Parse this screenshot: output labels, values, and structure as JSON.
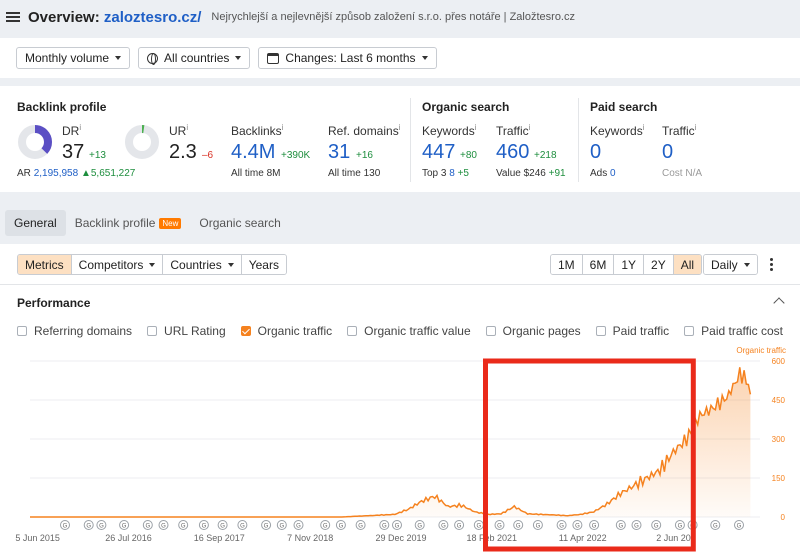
{
  "header": {
    "title_prefix": "Overview: ",
    "domain": "zaloztesro.cz/",
    "subtitle": "Nejrychlejší a nejlevnější způsob založení s.r.o. přes notáře | Založtesro.cz"
  },
  "filters": {
    "volume": "Monthly volume",
    "countries": "All countries",
    "changes": "Changes: Last 6 months"
  },
  "backlink_profile": {
    "title": "Backlink profile",
    "dr_label": "DR",
    "dr_value": "37",
    "dr_delta": "+13",
    "dr_fraction": 0.37,
    "ur_label": "UR",
    "ur_value": "2.3",
    "ur_delta": "–6",
    "ur_fraction": 0.023,
    "ar_label": "AR",
    "ar_value": "2,195,958",
    "ar_delta": "▲5,651,227",
    "backlinks_label": "Backlinks",
    "backlinks_value": "4.4M",
    "backlinks_delta": "+390K",
    "backlinks_alltime_label": "All time",
    "backlinks_alltime": "8M",
    "refdomains_label": "Ref. domains",
    "refdomains_value": "31",
    "refdomains_delta": "+16",
    "refdomains_alltime_label": "All time",
    "refdomains_alltime": "130"
  },
  "organic_search": {
    "title": "Organic search",
    "keywords_label": "Keywords",
    "keywords_value": "447",
    "keywords_delta": "+80",
    "top3_label": "Top 3",
    "top3_value": "8",
    "top3_delta": "+5",
    "traffic_label": "Traffic",
    "traffic_value": "460",
    "traffic_delta": "+218",
    "value_label": "Value",
    "value_value": "$246",
    "value_delta": "+91"
  },
  "paid_search": {
    "title": "Paid search",
    "keywords_label": "Keywords",
    "keywords_value": "0",
    "ads_label": "Ads",
    "ads_value": "0",
    "traffic_label": "Traffic",
    "traffic_value": "0",
    "cost_label": "Cost",
    "cost_value": "N/A"
  },
  "tabs": [
    {
      "label": "General"
    },
    {
      "label": "Backlink profile",
      "badge": "New"
    },
    {
      "label": "Organic search"
    }
  ],
  "toolbar": {
    "left": [
      "Metrics",
      "Competitors",
      "Countries",
      "Years"
    ],
    "ranges": [
      "1M",
      "6M",
      "1Y",
      "2Y",
      "All"
    ],
    "interval": "Daily"
  },
  "performance": {
    "title": "Performance",
    "checkboxes": [
      {
        "label": "Referring domains",
        "checked": false
      },
      {
        "label": "URL Rating",
        "checked": false
      },
      {
        "label": "Organic traffic",
        "checked": true
      },
      {
        "label": "Organic traffic value",
        "checked": false
      },
      {
        "label": "Organic pages",
        "checked": false
      },
      {
        "label": "Paid traffic",
        "checked": false
      },
      {
        "label": "Paid traffic cost",
        "checked": false
      }
    ]
  },
  "colors": {
    "accent": "#f5821f",
    "link": "#1f5fc6",
    "highlight": "#ea2a1a"
  },
  "chart_data": {
    "type": "area",
    "series": [
      {
        "name": "Organic traffic",
        "points": [
          [
            "2015-05-01",
            0
          ],
          [
            "2019-04-01",
            0
          ],
          [
            "2019-12-01",
            10
          ],
          [
            "2020-02-01",
            30
          ],
          [
            "2020-04-01",
            60
          ],
          [
            "2020-06-01",
            80
          ],
          [
            "2020-08-01",
            40
          ],
          [
            "2020-10-01",
            45
          ],
          [
            "2020-12-01",
            20
          ],
          [
            "2021-02-01",
            10
          ],
          [
            "2021-04-01",
            12
          ],
          [
            "2021-06-01",
            40
          ],
          [
            "2021-08-01",
            12
          ],
          [
            "2021-10-01",
            10
          ],
          [
            "2021-12-01",
            8
          ],
          [
            "2022-02-01",
            5
          ],
          [
            "2022-04-01",
            10
          ],
          [
            "2022-06-01",
            20
          ],
          [
            "2022-08-01",
            50
          ],
          [
            "2022-10-01",
            90
          ],
          [
            "2022-12-01",
            120
          ],
          [
            "2023-02-01",
            150
          ],
          [
            "2023-04-01",
            180
          ],
          [
            "2023-06-01",
            250
          ],
          [
            "2023-08-01",
            300
          ],
          [
            "2023-10-01",
            390
          ],
          [
            "2023-12-01",
            420
          ],
          [
            "2024-02-01",
            460
          ],
          [
            "2024-03-01",
            500
          ],
          [
            "2024-04-01",
            550
          ],
          [
            "2024-05-01",
            530
          ],
          [
            "2024-05-20",
            470
          ]
        ]
      }
    ],
    "y_axis_label": "Organic traffic",
    "yticks": [
      0,
      150,
      300,
      450,
      600
    ],
    "ylim": [
      0,
      600
    ],
    "xticks": [
      "5 Jun 2015",
      "26 Jul 2016",
      "16 Sep 2017",
      "7 Nov 2018",
      "29 Dec 2019",
      "18 Feb 2021",
      "11 Apr 2022",
      "2 Jun 20"
    ],
    "xtick_dates": [
      "2015-06-05",
      "2016-07-26",
      "2017-09-16",
      "2018-11-07",
      "2019-12-29",
      "2021-02-18",
      "2022-04-11",
      "2023-06-02"
    ],
    "x_domain": [
      "2015-05-01",
      "2024-06-10"
    ],
    "grid": true,
    "annotation_marker": "G",
    "annotation_count": 35,
    "highlight": {
      "from": "2021-01-20",
      "to": "2023-09-01"
    }
  }
}
